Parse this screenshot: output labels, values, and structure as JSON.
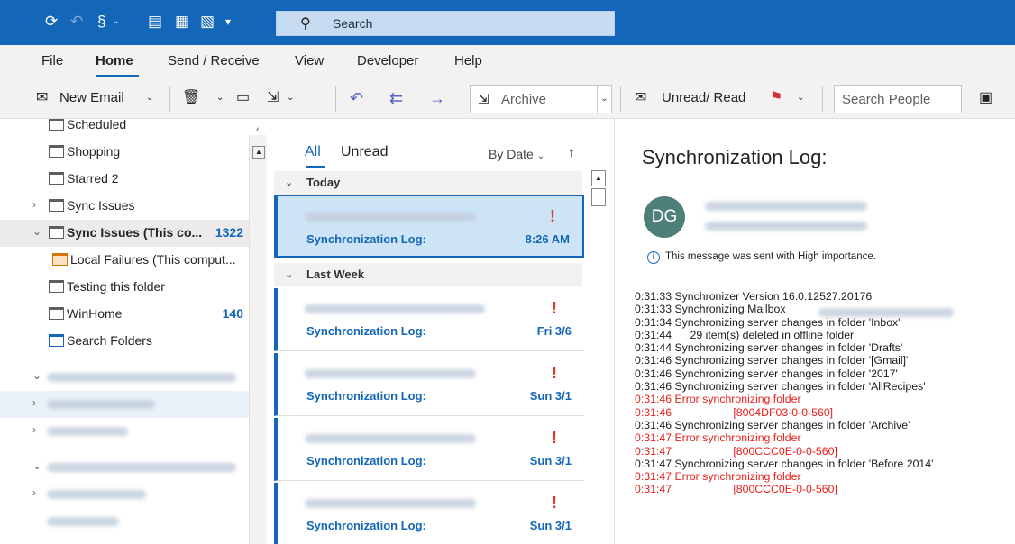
{
  "titlebar": {
    "search_label": "Search",
    "icons": [
      "refresh-icon",
      "undo-icon",
      "sync-icon",
      "form-icon",
      "calendar-form-icon",
      "save-form-icon",
      "customize-dropdown-icon",
      "search-icon"
    ],
    "accent": "#1467b8"
  },
  "menu": {
    "tabs": [
      "File",
      "Home",
      "Send / Receive",
      "View",
      "Developer",
      "Help"
    ],
    "active": "Home"
  },
  "ribbon": {
    "new_email": "New Email",
    "archive": "Archive",
    "unread_read": "Unread/ Read",
    "search_people_placeholder": "Search People",
    "icons": [
      "mail-icon",
      "delete-icon",
      "archive-box-icon",
      "move-icon",
      "reply-icon",
      "reply-all-icon",
      "forward-icon",
      "envelope-open-icon",
      "flag-icon",
      "address-book-icon"
    ]
  },
  "folders": [
    {
      "label": "Scheduled"
    },
    {
      "label": "Shopping"
    },
    {
      "label": "Starred 2"
    },
    {
      "label": "Sync Issues"
    },
    {
      "label": "Sync Issues (This co...",
      "count": "1322"
    },
    {
      "label": "Local Failures (This comput..."
    },
    {
      "label": "Testing this folder"
    },
    {
      "label": "WinHome",
      "count": "140"
    },
    {
      "label": "Search Folders"
    }
  ],
  "message_list": {
    "tab_all": "All",
    "tab_unread": "Unread",
    "sort": "By Date",
    "groups": [
      "Today",
      "Last Week"
    ],
    "items": [
      {
        "subject": "Synchronization Log:",
        "time": "8:26 AM",
        "importance": "!"
      },
      {
        "subject": "Synchronization Log:",
        "time": "Fri 3/6",
        "importance": "!"
      },
      {
        "subject": "Synchronization Log:",
        "time": "Sun 3/1",
        "importance": "!"
      },
      {
        "subject": "Synchronization Log:",
        "time": "Sun 3/1",
        "importance": "!"
      },
      {
        "subject": "Synchronization Log:",
        "time": "Sun 3/1",
        "importance": "!"
      }
    ]
  },
  "reading": {
    "title": "Synchronization Log:",
    "avatar": "DG",
    "importance_note": "This message was sent with High importance.",
    "log_lines": [
      {
        "text": "0:31:33 Synchronizer Version 16.0.12527.20176",
        "error": false
      },
      {
        "text": "0:31:33 Synchronizing Mailbox",
        "error": false
      },
      {
        "text": "0:31:34 Synchronizing server changes in folder 'Inbox'",
        "error": false
      },
      {
        "text": "0:31:44      29 item(s) deleted in offline folder",
        "error": false
      },
      {
        "text": "0:31:44 Synchronizing server changes in folder 'Drafts'",
        "error": false
      },
      {
        "text": "0:31:46 Synchronizing server changes in folder '[Gmail]'",
        "error": false
      },
      {
        "text": "0:31:46 Synchronizing server changes in folder '2017'",
        "error": false
      },
      {
        "text": "0:31:46 Synchronizing server changes in folder 'AllRecipes'",
        "error": false
      },
      {
        "text": "0:31:46 Error synchronizing folder",
        "error": true
      },
      {
        "text": "0:31:46                    [8004DF03-0-0-560]",
        "error": true
      },
      {
        "text": "0:31:46 Synchronizing server changes in folder 'Archive'",
        "error": false
      },
      {
        "text": "0:31:47 Error synchronizing folder",
        "error": true
      },
      {
        "text": "0:31:47                    [800CCC0E-0-0-560]",
        "error": true
      },
      {
        "text": "0:31:47 Synchronizing server changes in folder 'Before 2014'",
        "error": false
      },
      {
        "text": "0:31:47 Error synchronizing folder",
        "error": true
      },
      {
        "text": "0:31:47                    [800CCC0E-0-0-560]",
        "error": true
      }
    ],
    "error_color": "#e8201b"
  }
}
